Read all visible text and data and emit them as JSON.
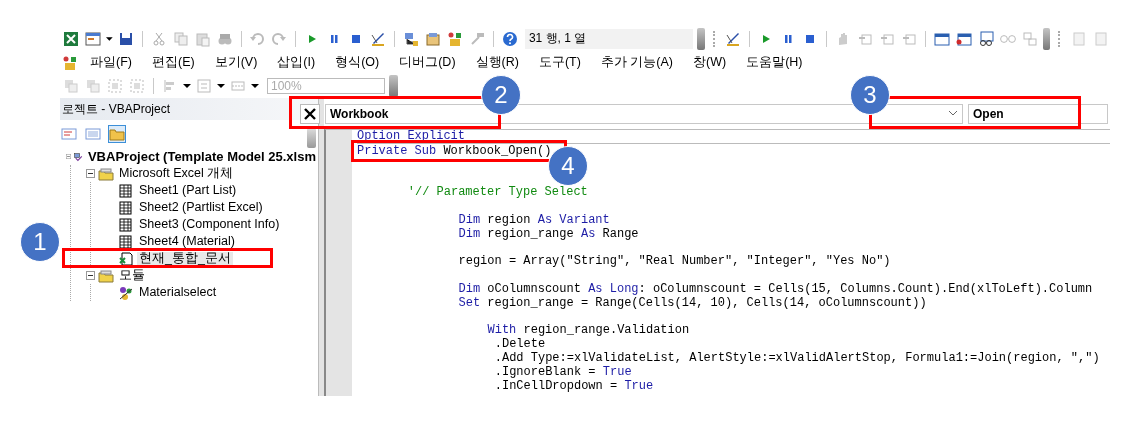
{
  "toolbar": {
    "position_field": "31 행, 1 열"
  },
  "menu": [
    {
      "label": "파일(F)"
    },
    {
      "label": "편집(E)"
    },
    {
      "label": "보기(V)"
    },
    {
      "label": "삽입(I)"
    },
    {
      "label": "형식(O)"
    },
    {
      "label": "디버그(D)"
    },
    {
      "label": "실행(R)"
    },
    {
      "label": "도구(T)"
    },
    {
      "label": "추가 기능(A)"
    },
    {
      "label": "창(W)"
    },
    {
      "label": "도움말(H)"
    }
  ],
  "format_toolbar": {
    "zoom": "100%"
  },
  "project_explorer": {
    "title": "로젝트 - VBAProject",
    "toggle_folders_pressed": true,
    "tree": [
      {
        "label": "VBAProject (Template Model 25.xlsm",
        "kind": "project",
        "expanded": true,
        "selected": false,
        "children": [
          {
            "label": "Microsoft Excel 개체",
            "kind": "folder",
            "expanded": true,
            "selected": false,
            "children": [
              {
                "label": "Sheet1 (Part List)",
                "kind": "sheet",
                "selected": false
              },
              {
                "label": "Sheet2 (Partlist Excel)",
                "kind": "sheet",
                "selected": false
              },
              {
                "label": "Sheet3 (Component Info)",
                "kind": "sheet",
                "selected": false
              },
              {
                "label": "Sheet4 (Material)",
                "kind": "sheet",
                "selected": false
              },
              {
                "label": "현재_통합_문서",
                "kind": "workbook",
                "selected": true
              }
            ]
          },
          {
            "label": "모듈",
            "kind": "folder",
            "expanded": true,
            "selected": false,
            "children": [
              {
                "label": "Materialselect",
                "kind": "module",
                "selected": false
              }
            ]
          }
        ]
      }
    ]
  },
  "code_window": {
    "object": "Workbook",
    "procedure": "Open",
    "lines": [
      {
        "kind": "code",
        "segments": [
          {
            "kind": "keyword",
            "text": "Option Explicit"
          }
        ]
      },
      {
        "kind": "code",
        "segments": [
          {
            "kind": "keyword",
            "text": "Private Sub"
          },
          {
            "kind": "plain",
            "text": " Workbook_Open()"
          }
        ]
      },
      {
        "kind": "blank"
      },
      {
        "kind": "blank"
      },
      {
        "kind": "code",
        "segments": [
          {
            "kind": "comment",
            "text": "'// Parameter Type Select"
          }
        ]
      },
      {
        "kind": "blank"
      },
      {
        "kind": "code",
        "segments": [
          {
            "kind": "keyword",
            "text": "Dim"
          },
          {
            "kind": "plain",
            "text": " region "
          },
          {
            "kind": "keyword",
            "text": "As Variant"
          }
        ]
      },
      {
        "kind": "code",
        "segments": [
          {
            "kind": "keyword",
            "text": "Dim"
          },
          {
            "kind": "plain",
            "text": " region_range "
          },
          {
            "kind": "keyword",
            "text": "As"
          },
          {
            "kind": "plain",
            "text": " Range"
          }
        ]
      },
      {
        "kind": "blank"
      },
      {
        "kind": "code",
        "segments": [
          {
            "kind": "plain",
            "text": "region = Array(\"String\", \"Real Number\", \"Integer\", \"Yes No\")"
          }
        ]
      },
      {
        "kind": "blank"
      },
      {
        "kind": "code",
        "segments": [
          {
            "kind": "keyword",
            "text": "Dim"
          },
          {
            "kind": "plain",
            "text": " oColumnscount "
          },
          {
            "kind": "keyword",
            "text": "As Long"
          },
          {
            "kind": "plain",
            "text": ": oColumnscount = Cells(15, Columns.Count).End(xlToLeft).Column"
          }
        ]
      },
      {
        "kind": "code",
        "segments": [
          {
            "kind": "keyword",
            "text": "Set"
          },
          {
            "kind": "plain",
            "text": " region_range = Range(Cells(14, 10), Cells(14, oColumnscount))"
          }
        ]
      },
      {
        "kind": "blank"
      },
      {
        "kind": "code",
        "segments": [
          {
            "kind": "keyword",
            "text": "With"
          },
          {
            "kind": "plain",
            "text": " region_range.Validation"
          }
        ]
      },
      {
        "kind": "code",
        "segments": [
          {
            "kind": "plain",
            "text": ".Delete"
          }
        ]
      },
      {
        "kind": "code",
        "segments": [
          {
            "kind": "plain",
            "text": ".Add Type:=xlValidateList, AlertStyle:=xlValidAlertStop, Formula1:=Join(region, \",\")"
          }
        ]
      },
      {
        "kind": "code",
        "segments": [
          {
            "kind": "plain",
            "text": ".IgnoreBlank = "
          },
          {
            "kind": "keyword",
            "text": "True"
          }
        ]
      },
      {
        "kind": "code",
        "segments": [
          {
            "kind": "plain",
            "text": ".InCellDropdown = "
          },
          {
            "kind": "keyword",
            "text": "True"
          }
        ]
      }
    ]
  },
  "annotations": [
    {
      "label": "1"
    },
    {
      "label": "2"
    },
    {
      "label": "3"
    },
    {
      "label": "4"
    }
  ]
}
